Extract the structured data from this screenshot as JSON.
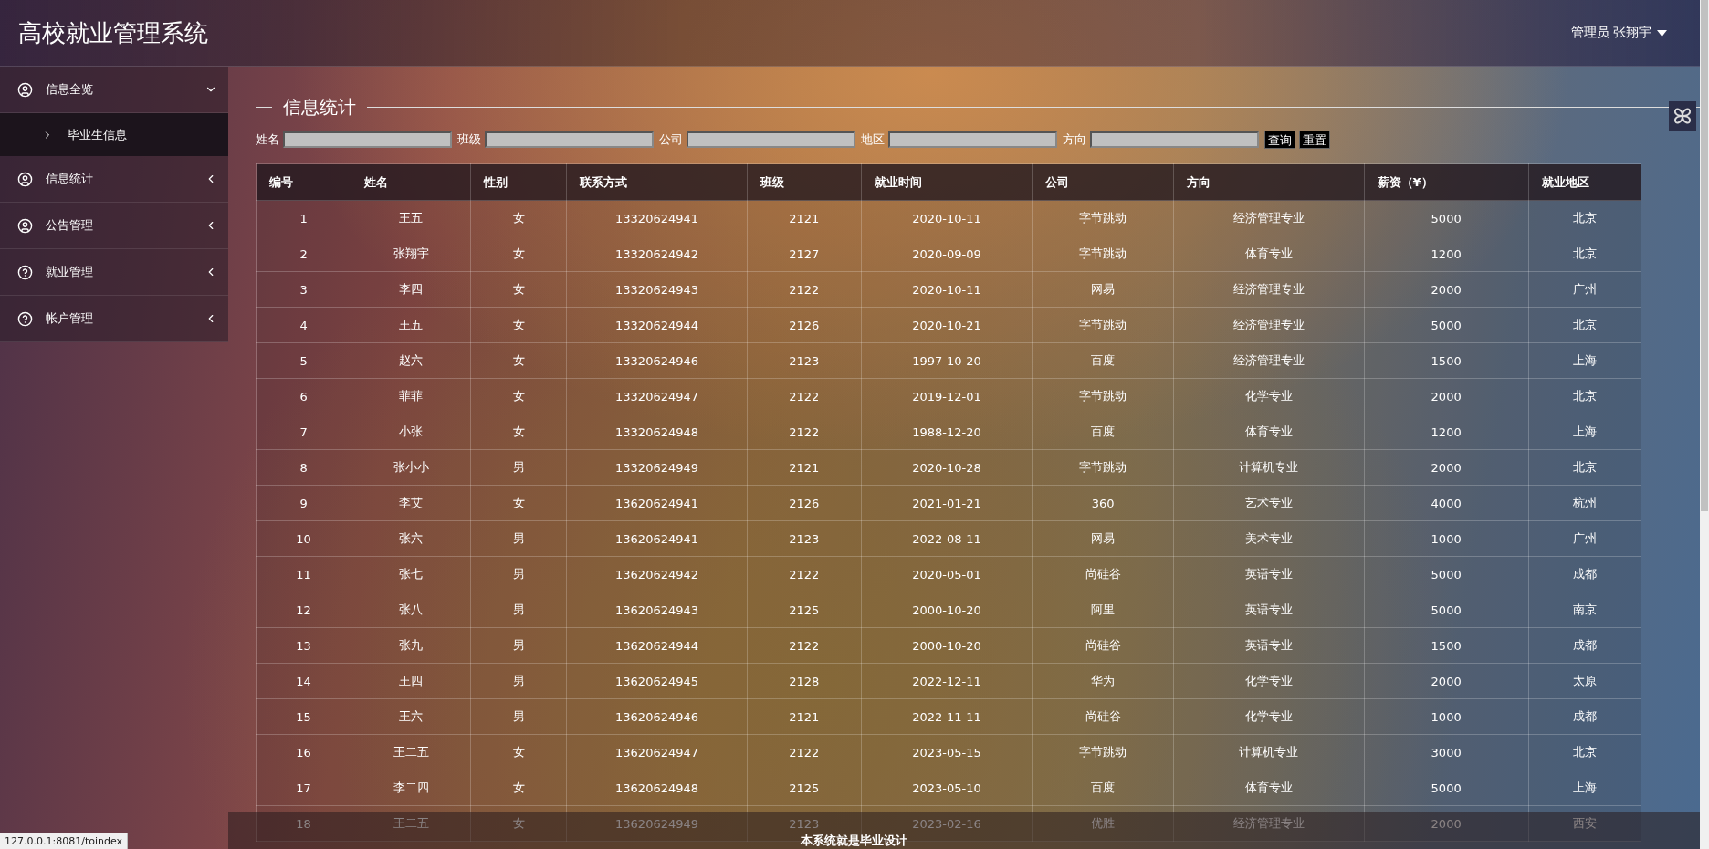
{
  "header": {
    "title": "高校就业管理系统",
    "user": "管理员 张翔宇"
  },
  "sidebar": {
    "items": [
      {
        "label": "信息全览",
        "kind": "user",
        "expanded": true,
        "children": [
          {
            "label": "毕业生信息"
          }
        ]
      },
      {
        "label": "信息统计",
        "kind": "user",
        "expanded": false
      },
      {
        "label": "公告管理",
        "kind": "user",
        "expanded": false
      },
      {
        "label": "就业管理",
        "kind": "help",
        "expanded": false
      },
      {
        "label": "帐户管理",
        "kind": "help",
        "expanded": false
      }
    ]
  },
  "section_title": "信息统计",
  "filters": [
    {
      "label": "姓名"
    },
    {
      "label": "班级"
    },
    {
      "label": "公司"
    },
    {
      "label": "地区"
    },
    {
      "label": "方向"
    }
  ],
  "buttons": [
    "查询",
    "重置"
  ],
  "table": {
    "columns": [
      "编号",
      "姓名",
      "性别",
      "联系方式",
      "班级",
      "就业时间",
      "公司",
      "方向",
      "薪资（¥）",
      "就业地区"
    ],
    "rows": [
      [
        "1",
        "王五",
        "女",
        "13320624941",
        "2121",
        "2020-10-11",
        "字节跳动",
        "经济管理专业",
        "5000",
        "北京"
      ],
      [
        "2",
        "张翔宇",
        "女",
        "13320624942",
        "2127",
        "2020-09-09",
        "字节跳动",
        "体育专业",
        "1200",
        "北京"
      ],
      [
        "3",
        "李四",
        "女",
        "13320624943",
        "2122",
        "2020-10-11",
        "网易",
        "经济管理专业",
        "2000",
        "广州"
      ],
      [
        "4",
        "王五",
        "女",
        "13320624944",
        "2126",
        "2020-10-21",
        "字节跳动",
        "经济管理专业",
        "5000",
        "北京"
      ],
      [
        "5",
        "赵六",
        "女",
        "13320624946",
        "2123",
        "1997-10-20",
        "百度",
        "经济管理专业",
        "1500",
        "上海"
      ],
      [
        "6",
        "菲菲",
        "女",
        "13320624947",
        "2122",
        "2019-12-01",
        "字节跳动",
        "化学专业",
        "2000",
        "北京"
      ],
      [
        "7",
        "小张",
        "女",
        "13320624948",
        "2122",
        "1988-12-20",
        "百度",
        "体育专业",
        "1200",
        "上海"
      ],
      [
        "8",
        "张小小",
        "男",
        "13320624949",
        "2121",
        "2020-10-28",
        "字节跳动",
        "计算机专业",
        "2000",
        "北京"
      ],
      [
        "9",
        "李艾",
        "女",
        "13620624941",
        "2126",
        "2021-01-21",
        "360",
        "艺术专业",
        "4000",
        "杭州"
      ],
      [
        "10",
        "张六",
        "男",
        "13620624941",
        "2123",
        "2022-08-11",
        "网易",
        "美术专业",
        "1000",
        "广州"
      ],
      [
        "11",
        "张七",
        "男",
        "13620624942",
        "2122",
        "2020-05-01",
        "尚硅谷",
        "英语专业",
        "5000",
        "成都"
      ],
      [
        "12",
        "张八",
        "男",
        "13620624943",
        "2125",
        "2000-10-20",
        "阿里",
        "英语专业",
        "5000",
        "南京"
      ],
      [
        "13",
        "张九",
        "男",
        "13620624944",
        "2122",
        "2000-10-20",
        "尚硅谷",
        "英语专业",
        "1500",
        "成都"
      ],
      [
        "14",
        "王四",
        "男",
        "13620624945",
        "2128",
        "2022-12-11",
        "华为",
        "化学专业",
        "2000",
        "太原"
      ],
      [
        "15",
        "王六",
        "男",
        "13620624946",
        "2121",
        "2022-11-11",
        "尚硅谷",
        "化学专业",
        "1000",
        "成都"
      ],
      [
        "16",
        "王二五",
        "女",
        "13620624947",
        "2122",
        "2023-05-15",
        "字节跳动",
        "计算机专业",
        "3000",
        "北京"
      ],
      [
        "17",
        "李二四",
        "女",
        "13620624948",
        "2125",
        "2023-05-10",
        "百度",
        "体育专业",
        "5000",
        "上海"
      ],
      [
        "18",
        "王二五",
        "女",
        "13620624949",
        "2123",
        "2023-02-16",
        "优胜",
        "经济管理专业",
        "2000",
        "西安"
      ]
    ]
  },
  "footer": "本系统就是毕业设计",
  "status_url": "127.0.0.1:8081/toindex"
}
